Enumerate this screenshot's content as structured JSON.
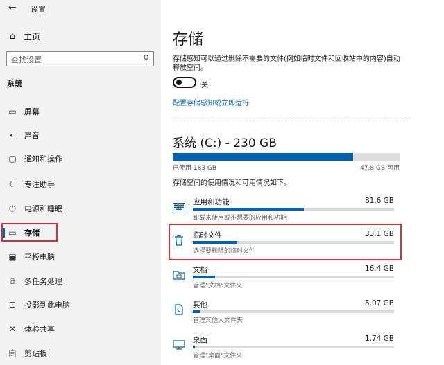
{
  "window": {
    "back_icon": "back-arrow-icon",
    "title": "设置"
  },
  "sidebar": {
    "home_label": "主页",
    "search_placeholder": "查找设置",
    "section_label": "系统",
    "items": [
      {
        "label": "屏幕",
        "icon": "display-icon",
        "active": false
      },
      {
        "label": "声音",
        "icon": "sound-icon",
        "active": false
      },
      {
        "label": "通知和操作",
        "icon": "notification-icon",
        "active": false
      },
      {
        "label": "专注助手",
        "icon": "moon-icon",
        "active": false
      },
      {
        "label": "电源和睡眠",
        "icon": "power-icon",
        "active": false
      },
      {
        "label": "存储",
        "icon": "storage-icon",
        "active": true
      },
      {
        "label": "平板电脑",
        "icon": "tablet-icon",
        "active": false
      },
      {
        "label": "多任务处理",
        "icon": "multitask-icon",
        "active": false
      },
      {
        "label": "投影到此电脑",
        "icon": "project-icon",
        "active": false
      },
      {
        "label": "体验共享",
        "icon": "share-icon",
        "active": false
      },
      {
        "label": "剪贴板",
        "icon": "clipboard-icon",
        "active": false
      }
    ]
  },
  "main": {
    "title": "存储",
    "description": "存储感知可以通过删除不需要的文件(例如临时文件和回收站中的内容)自动释放空间。",
    "toggle_state": "关",
    "configure_link": "配置存储感知或立即运行",
    "drive": {
      "title": "系统 (C:) - 230 GB",
      "used": "已使用 183 GB",
      "available": "47.8 GB 可用",
      "used_fraction": 0.795
    },
    "info_text": "存储空间的使用情况和可用情况如下。",
    "categories": [
      {
        "name": "应用和功能",
        "size": "81.6 GB",
        "sub": "卸载未使用或不想要的应用和功能",
        "icon": "keyboard-icon",
        "fraction": 0.55
      },
      {
        "name": "临时文件",
        "size": "33.1 GB",
        "sub": "选择要删除的临时文件",
        "icon": "trash-icon",
        "fraction": 0.22
      },
      {
        "name": "文档",
        "size": "16.4 GB",
        "sub": "管理\"文档\"文件夹",
        "icon": "folder-icon",
        "fraction": 0.11
      },
      {
        "name": "其他",
        "size": "5.07 GB",
        "sub": "管理其他大文件夹",
        "icon": "file-icon",
        "fraction": 0.035
      },
      {
        "name": "桌面",
        "size": "1.74 GB",
        "sub": "管理\"桌面\"文件夹",
        "icon": "monitor-icon",
        "fraction": 0.012
      }
    ]
  },
  "colors": {
    "accent": "#0063b1",
    "highlight": "#d6323a",
    "sidebar_bg": "#f2f2f2"
  }
}
